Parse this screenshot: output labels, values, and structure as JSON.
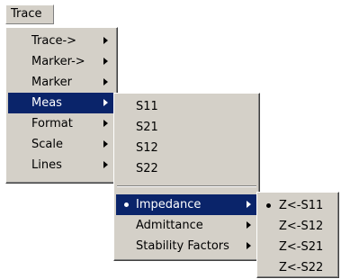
{
  "menubar": {
    "trace_label": "Trace"
  },
  "trace_menu": {
    "items": [
      {
        "label": "Trace->",
        "has_submenu": true,
        "selected": false
      },
      {
        "label": "Marker->",
        "has_submenu": true,
        "selected": false
      },
      {
        "label": "Marker",
        "has_submenu": true,
        "selected": false
      },
      {
        "label": "Meas",
        "has_submenu": true,
        "selected": true
      },
      {
        "label": "Format",
        "has_submenu": true,
        "selected": false
      },
      {
        "label": "Scale",
        "has_submenu": true,
        "selected": false
      },
      {
        "label": "Lines",
        "has_submenu": true,
        "selected": false
      }
    ]
  },
  "meas_menu": {
    "items": [
      {
        "label": "S11"
      },
      {
        "label": "S21"
      },
      {
        "label": "S12"
      },
      {
        "label": "S22"
      }
    ],
    "items2": [
      {
        "label": "Impedance",
        "has_submenu": true,
        "selected": true,
        "checked": true
      },
      {
        "label": "Admittance",
        "has_submenu": true,
        "selected": false,
        "checked": false
      },
      {
        "label": "Stability Factors",
        "has_submenu": true,
        "selected": false,
        "checked": false
      }
    ]
  },
  "impedance_menu": {
    "items": [
      {
        "label": "Z<-S11",
        "checked": true
      },
      {
        "label": "Z<-S12",
        "checked": false
      },
      {
        "label": "Z<-S21",
        "checked": false
      },
      {
        "label": "Z<-S22",
        "checked": false
      }
    ]
  },
  "colors": {
    "menu_bg": "#d4d0c8",
    "highlight": "#0a246a",
    "highlight_text": "#ffffff"
  }
}
